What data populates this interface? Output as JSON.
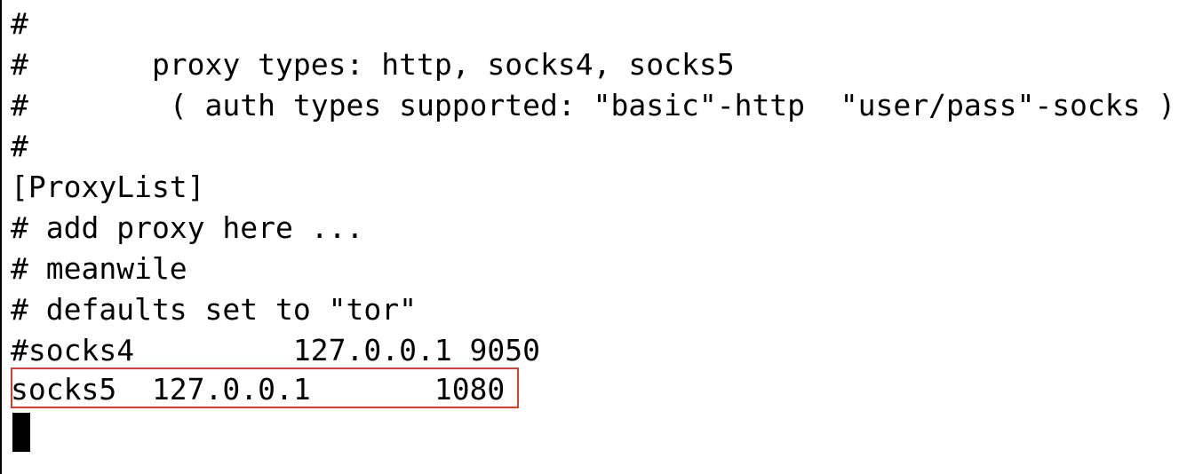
{
  "terminal": {
    "lines": [
      "#",
      "#       proxy types: http, socks4, socks5",
      "#        ( auth types supported: \"basic\"-http  \"user/pass\"-socks )",
      "#",
      "[ProxyList]",
      "# add proxy here ...",
      "# meanwile",
      "# defaults set to \"tor\"",
      "#socks4         127.0.0.1 9050",
      "socks5  127.0.0.1       1080"
    ],
    "highlight_color": "#d9402b"
  }
}
